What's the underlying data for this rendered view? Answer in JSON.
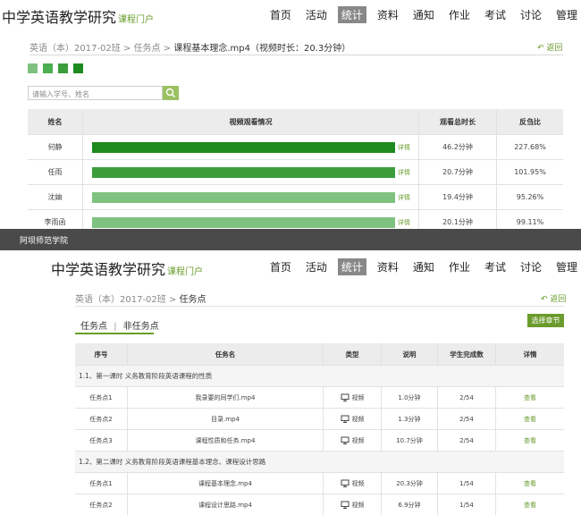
{
  "top": {
    "brand": "中学英语教学研究",
    "brand_sub": "课程门户",
    "nav": [
      "首页",
      "活动",
      "统计",
      "资料",
      "通知",
      "作业",
      "考试",
      "讨论",
      "管理"
    ],
    "nav_active": 2,
    "crumb_1": "英语（本）2017-02班",
    "crumb_2": "任务点",
    "crumb_3": "课程基本理念.mp4（视频时长：20.3分钟）",
    "sep": ">",
    "back": "返回",
    "legend_colors": [
      "#7fc27f",
      "#4caf50",
      "#3b9e3b",
      "#1e8a1e"
    ],
    "search_placeholder": "请输入学号、姓名",
    "table": {
      "headers": [
        "姓名",
        "视频观看情况",
        "观看总时长",
        "反刍比"
      ],
      "rows": [
        {
          "name": "何静",
          "progress": 1.0,
          "color": "#1e8a1e",
          "detail": "详情",
          "duration": "46.2分钟",
          "ratio": "227.68%"
        },
        {
          "name": "任雨",
          "progress": 1.0,
          "color": "#3b9e3b",
          "detail": "详情",
          "duration": "20.7分钟",
          "ratio": "101.95%"
        },
        {
          "name": "沈妯",
          "progress": 1.0,
          "color": "#7fc27f",
          "detail": "详情",
          "duration": "19.4分钟",
          "ratio": "95.26%"
        },
        {
          "name": "李雨函",
          "progress": 1.0,
          "color": "#7fc27f",
          "detail": "详情",
          "duration": "20.1分钟",
          "ratio": "99.11%"
        }
      ]
    }
  },
  "dark_bar": {
    "title": "阿坝师范学院"
  },
  "bottom": {
    "brand": "中学英语教学研究",
    "brand_sub": "课程门户",
    "nav": [
      "首页",
      "活动",
      "统计",
      "资料",
      "通知",
      "作业",
      "考试",
      "讨论",
      "管理"
    ],
    "nav_active": 2,
    "crumb_1": "英语（本）2017-02班",
    "crumb_2": "任务点",
    "sep": ">",
    "back": "返回",
    "tab_1": "任务点",
    "tab_sep": "|",
    "tab_2": "非任务点",
    "select_button": "选择章节",
    "table": {
      "headers": [
        "序号",
        "任务名",
        "类型",
        "说明",
        "学生完成数",
        "详情"
      ],
      "sections": [
        {
          "title": "1.1、第一课时 义务教育阶段英语课程的性质",
          "rows": [
            {
              "no": "任务点1",
              "name": "我录要的同学们.mp4",
              "type": "视频",
              "desc": "1.0分钟",
              "done": "2/54",
              "detail": "查看"
            },
            {
              "no": "任务点2",
              "name": "目录.mp4",
              "type": "视频",
              "desc": "1.3分钟",
              "done": "2/54",
              "detail": "查看"
            },
            {
              "no": "任务点3",
              "name": "课程性质和任务.mp4",
              "type": "视频",
              "desc": "10.7分钟",
              "done": "2/54",
              "detail": "查看"
            }
          ]
        },
        {
          "title": "1.2、第二课时 义务教育阶段英语课程基本理念、课程设计思路",
          "rows": [
            {
              "no": "任务点1",
              "name": "课程基本理念.mp4",
              "type": "视频",
              "desc": "20.3分钟",
              "done": "1/54",
              "detail": "查看"
            },
            {
              "no": "任务点2",
              "name": "课程设计思路.mp4",
              "type": "视频",
              "desc": "6.9分钟",
              "done": "1/54",
              "detail": "查看"
            }
          ]
        }
      ]
    }
  }
}
